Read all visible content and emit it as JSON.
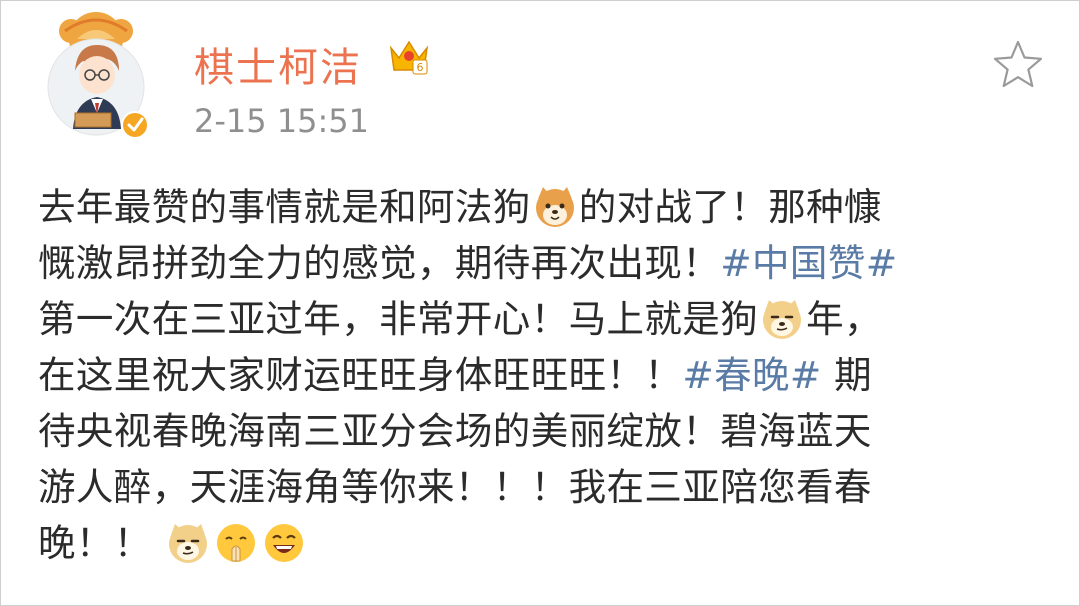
{
  "user": {
    "name": "棋士柯洁",
    "timestamp": "2-15 15:51",
    "verified_badge_color": "#f5a623",
    "name_color": "#eb7350"
  },
  "icons": [
    "avatar",
    "crown-level-badge-icon",
    "verified-badge-icon",
    "favorite-star-icon",
    "shiba-dog-emoji",
    "doge-emoji",
    "praying-emoji",
    "laughing-emoji"
  ],
  "post": {
    "line1": {
      "a": "去年最赞的事情就是和阿法狗",
      "b": "的对战了！那种慷"
    },
    "line2": {
      "a": "慨激昂拼劲全力的感觉，期待再次出现！",
      "tag": "#中国赞#"
    },
    "line3": {
      "a": "第一次在三亚过年，非常开心！马上就是狗",
      "b": "年，"
    },
    "line4": {
      "a": "在这里祝大家财运旺旺身体旺旺旺！！",
      "tag": "#春晚#",
      "b": "期"
    },
    "line5": {
      "a": "待央视春晚海南三亚分会场的美丽绽放！碧海蓝天"
    },
    "line6": {
      "a": "游人醉，天涯海角等你来！！！我在三亚陪您看春"
    },
    "line7": {
      "a": "晚！！"
    }
  },
  "link_color": "#5a7ba5"
}
